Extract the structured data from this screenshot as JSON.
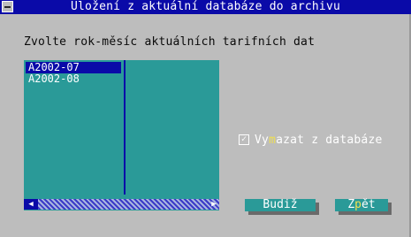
{
  "window": {
    "title": "Uložení z aktuální databáze do archivu",
    "system_menu_icon": "system-menu-icon"
  },
  "prompt": "Zvolte rok-měsíc aktuálních tarifních dat",
  "list": {
    "items": [
      {
        "label": "A2002-07",
        "selected": true
      },
      {
        "label": "A2002-08",
        "selected": false
      }
    ],
    "scroll_left_icon": "arrow-left-icon",
    "scroll_right_icon": "arrow-right-icon"
  },
  "checkbox": {
    "checked": true,
    "label_pre": "Vy",
    "label_hot": "m",
    "label_post": "azat z databáze"
  },
  "buttons": {
    "ok_label": "Budiž",
    "back_pre": "Z",
    "back_hot": "p",
    "back_post": "ět"
  },
  "colors": {
    "title_bar": "#0a0aa8",
    "dialog_bg": "#bdbdbd",
    "list_bg": "#2a9a98",
    "selection": "#0a0aa8",
    "hotkey": "#f0e050"
  }
}
